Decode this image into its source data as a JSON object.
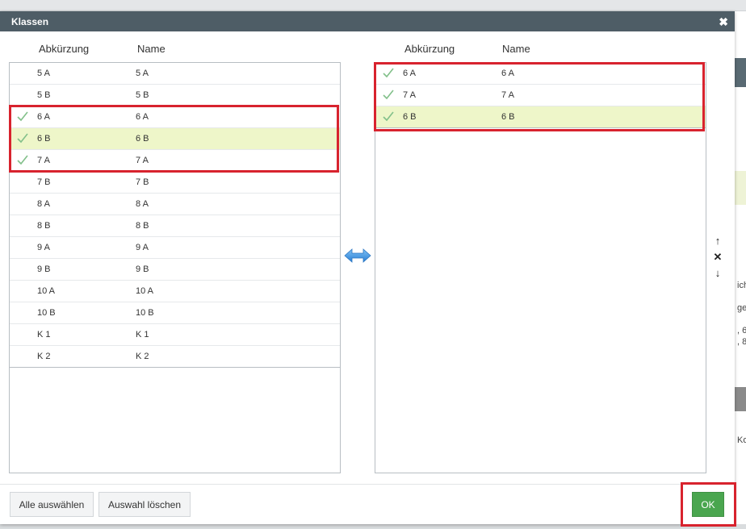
{
  "dialog": {
    "title": "Klassen",
    "close_glyph": "✖"
  },
  "columns": {
    "abbr": "Abkürzung",
    "name": "Name"
  },
  "left_list": [
    {
      "abbr": "5 A",
      "name": "5 A",
      "checked": false,
      "selected": false
    },
    {
      "abbr": "5 B",
      "name": "5 B",
      "checked": false,
      "selected": false
    },
    {
      "abbr": "6 A",
      "name": "6 A",
      "checked": true,
      "selected": false
    },
    {
      "abbr": "6 B",
      "name": "6 B",
      "checked": true,
      "selected": true
    },
    {
      "abbr": "7 A",
      "name": "7 A",
      "checked": true,
      "selected": false
    },
    {
      "abbr": "7 B",
      "name": "7 B",
      "checked": false,
      "selected": false
    },
    {
      "abbr": "8 A",
      "name": "8 A",
      "checked": false,
      "selected": false
    },
    {
      "abbr": "8 B",
      "name": "8 B",
      "checked": false,
      "selected": false
    },
    {
      "abbr": "9 A",
      "name": "9 A",
      "checked": false,
      "selected": false
    },
    {
      "abbr": "9 B",
      "name": "9 B",
      "checked": false,
      "selected": false
    },
    {
      "abbr": "10 A",
      "name": "10 A",
      "checked": false,
      "selected": false
    },
    {
      "abbr": "10 B",
      "name": "10 B",
      "checked": false,
      "selected": false
    },
    {
      "abbr": "K 1",
      "name": "K 1",
      "checked": false,
      "selected": false
    },
    {
      "abbr": "K 2",
      "name": "K 2",
      "checked": false,
      "selected": false
    }
  ],
  "right_list": [
    {
      "abbr": "6 A",
      "name": "6 A",
      "checked": true,
      "selected": false
    },
    {
      "abbr": "7 A",
      "name": "7 A",
      "checked": true,
      "selected": false
    },
    {
      "abbr": "6 B",
      "name": "6 B",
      "checked": true,
      "selected": true
    }
  ],
  "side_tools": {
    "up": "↑",
    "remove": "✕",
    "down": "↓"
  },
  "footer": {
    "select_all": "Alle auswählen",
    "clear_selection": "Auswahl löschen",
    "ok": "OK"
  },
  "background_fragments": [
    "ich",
    "ger",
    ", 6",
    ", 8",
    "Ko"
  ],
  "colors": {
    "titlebar": "#4e5d66",
    "selected_row": "#eef6c9",
    "check": "#82c08a",
    "highlight": "#d8232e",
    "ok_button": "#4aa64f",
    "swap_arrow": "#3b8fe0"
  },
  "icons": {
    "check": "check-icon",
    "swap": "swap-arrows-icon",
    "up": "arrow-up-icon",
    "remove": "remove-icon",
    "down": "arrow-down-icon",
    "close": "close-icon"
  }
}
